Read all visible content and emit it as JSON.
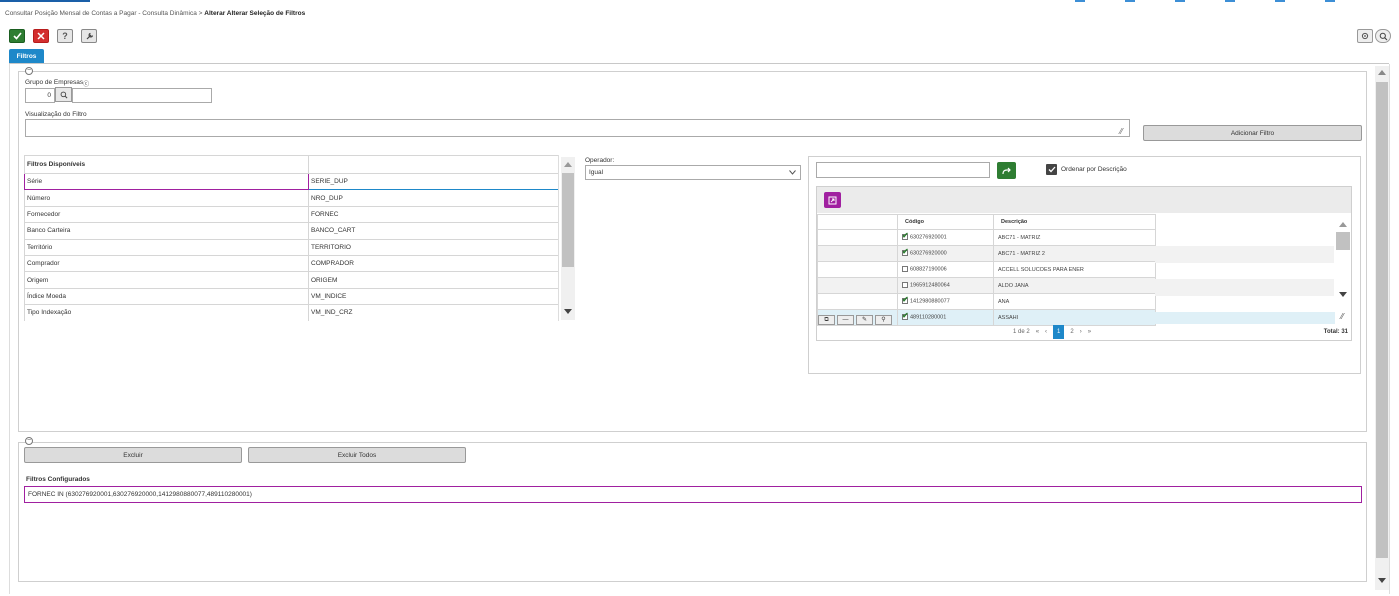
{
  "breadcrumb": {
    "parent": "Consultar Posição Mensal de Contas a Pagar - Consulta Dinâmica",
    "separator": ">",
    "current": "Alterar Alterar Seleção de Filtros"
  },
  "toolbar": {
    "ok_icon": "check-icon",
    "cancel_icon": "close-icon",
    "help_glyph": "?",
    "settings_icon": "wrench-icon"
  },
  "tab": {
    "label": "Filtros"
  },
  "grupo_empresas": {
    "label": "Grupo de Empresas",
    "value": "0",
    "desc": ""
  },
  "visualizacao": {
    "label": "Visualização do Filtro",
    "value": ""
  },
  "adicionar_filtro_label": "Adicionar Filtro",
  "filtros_disponiveis": {
    "header": "Filtros Disponíveis",
    "rows": [
      {
        "name": "Série",
        "code": "SERIE_DUP"
      },
      {
        "name": "Número",
        "code": "NRO_DUP"
      },
      {
        "name": "Fornecedor",
        "code": "FORNEC"
      },
      {
        "name": "Banco Carteira",
        "code": "BANCO_CART"
      },
      {
        "name": "Território",
        "code": "TERRITORIO"
      },
      {
        "name": "Comprador",
        "code": "COMPRADOR"
      },
      {
        "name": "Origem",
        "code": "ORIGEM"
      },
      {
        "name": "Índice Moeda",
        "code": "VM_INDICE"
      },
      {
        "name": "Tipo Indexação",
        "code": "VM_IND_CRZ"
      }
    ]
  },
  "operador": {
    "label": "Operador:",
    "value": "Igual"
  },
  "ordenar_label": "Ordenar por Descrição",
  "grid": {
    "col_codigo": "Código",
    "col_descricao": "Descrição",
    "rows": [
      {
        "checked": true,
        "codigo": "630276920001",
        "descricao": "ABC71 - MATRIZ"
      },
      {
        "checked": true,
        "codigo": "630276920000",
        "descricao": "ABC71 - MATRIZ 2"
      },
      {
        "checked": false,
        "codigo": "608827190006",
        "descricao": "ACCELL SOLUCOES PARA ENER"
      },
      {
        "checked": false,
        "codigo": "1965912480064",
        "descricao": "ALDO JANA"
      },
      {
        "checked": true,
        "codigo": "1412980880077",
        "descricao": "ANA"
      },
      {
        "checked": true,
        "codigo": "489110280001",
        "descricao": "ASSAHI"
      }
    ],
    "page_info": "1 de 2",
    "pages": [
      "1",
      "2"
    ],
    "total": "Total: 31"
  },
  "excluir_label": "Excluir",
  "excluir_todos_label": "Excluir Todos",
  "configurados": {
    "header": "Filtros Configurados",
    "value": "FORNEC IN (630276920001,630276920000,1412980880077,489110280001)"
  },
  "colors": {
    "accent": "#1e88c9",
    "selection": "#a020a0",
    "ok": "#2e7d32",
    "cancel": "#d32f2f"
  }
}
